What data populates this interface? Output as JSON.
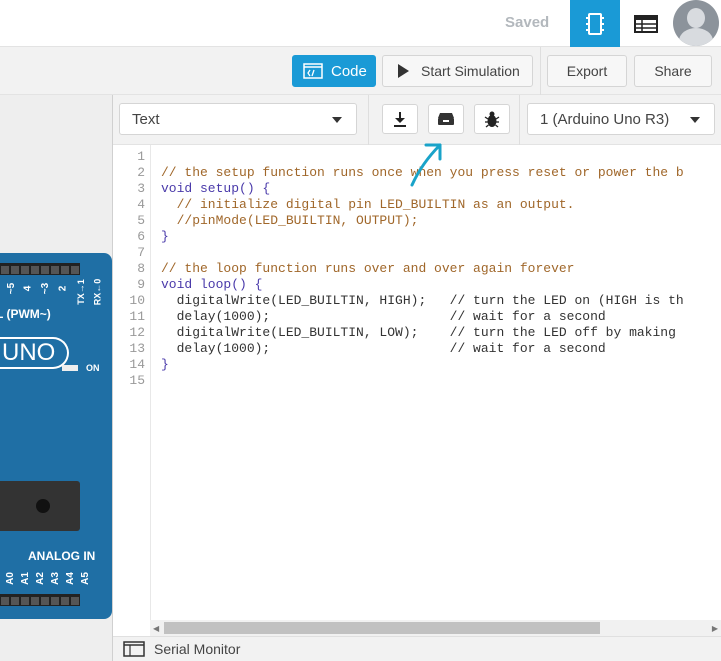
{
  "header": {
    "status": "Saved",
    "colors": {
      "accent": "#1a9ad6"
    }
  },
  "toolbar": {
    "code_label": "Code",
    "simulate_label": "Start Simulation",
    "export_label": "Export",
    "share_label": "Share"
  },
  "editor_toolbar": {
    "mode_value": "Text",
    "device_value": "1 (Arduino Uno R3)"
  },
  "board": {
    "pwm_label": "L (PWM~)",
    "pins_top": [
      "~5",
      "4",
      "~3",
      "2",
      "TX→1",
      "RX←0"
    ],
    "logo": "UNO",
    "on_label": "ON",
    "analog_label": "ANALOG IN",
    "pins_bottom": [
      "A0",
      "A1",
      "A2",
      "A3",
      "A4",
      "A5"
    ]
  },
  "code": {
    "lines": [
      "",
      "// the setup function runs once when you press reset or power the b",
      "void setup() {",
      "  // initialize digital pin LED_BUILTIN as an output.",
      "  //pinMode(LED_BUILTIN, OUTPUT);",
      "}",
      "",
      "// the loop function runs over and over again forever",
      "void loop() {",
      "  digitalWrite(LED_BUILTIN, HIGH);   // turn the LED on (HIGH is th",
      "  delay(1000);                       // wait for a second",
      "  digitalWrite(LED_BUILTIN, LOW);    // turn the LED off by making",
      "  delay(1000);                       // wait for a second",
      "}",
      ""
    ],
    "line_numbers": [
      "1",
      "2",
      "3",
      "4",
      "5",
      "6",
      "7",
      "8",
      "9",
      "10",
      "11",
      "12",
      "13",
      "14",
      "15"
    ]
  },
  "footer": {
    "serial_label": "Serial Monitor"
  }
}
